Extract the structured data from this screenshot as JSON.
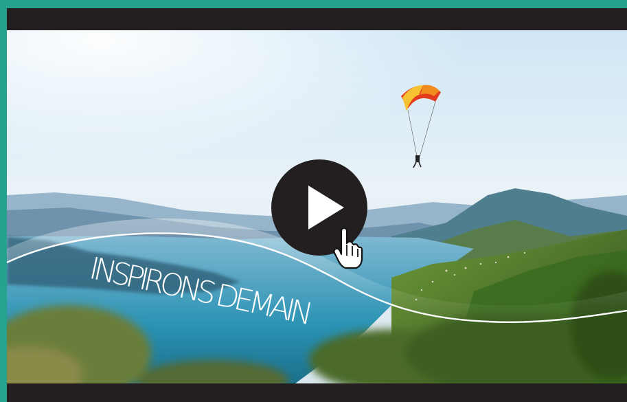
{
  "video": {
    "caption": "INSPIRONS DEMAIN"
  },
  "controls": {
    "play_icon": "play-icon",
    "cursor_icon": "hand-pointer-icon"
  },
  "colors": {
    "frame": "#26a38e",
    "player_bg": "#231f20",
    "play_button": "#231f20",
    "play_triangle": "#ffffff"
  }
}
